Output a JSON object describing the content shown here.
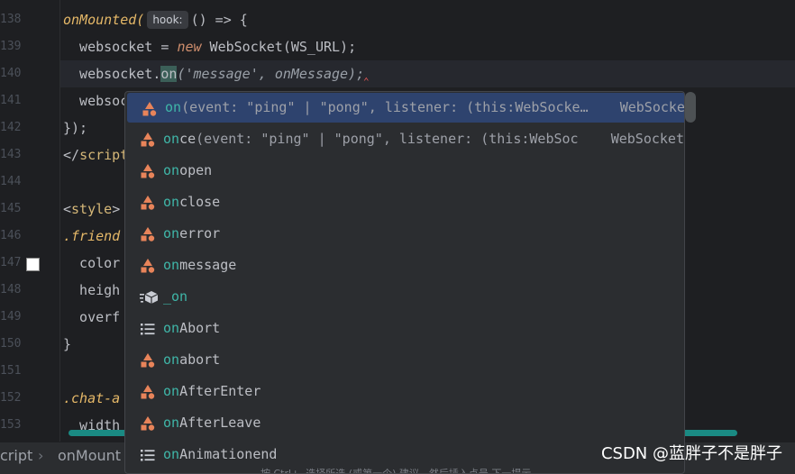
{
  "editor": {
    "line_numbers": [
      "138",
      "139",
      "140",
      "141",
      "142",
      "143",
      "144",
      "145",
      "146",
      "147",
      "148",
      "149",
      "150",
      "151",
      "152",
      "153"
    ],
    "lines": {
      "l138_fn": "onMounted(",
      "l138_hint": "hook:",
      "l138_rest": "() => {",
      "l139_a": "  websocket = ",
      "l139_kw": "new",
      "l139_b": " WebSocket(WS_URL);",
      "l140_a": "  websocket.",
      "l140_match": "on",
      "l140_paren": "(",
      "l140_str": "'message'",
      "l140_sep": ", ",
      "l140_param": "onMessage",
      "l140_end": ");",
      "l141": "  websoc",
      "l142": "});",
      "l143_a": "</",
      "l143_b": "script",
      "l145_a": "<",
      "l145_b": "style",
      "l145_c": ">",
      "l146": ".friend",
      "l147": "  color",
      "l148": "  heigh",
      "l149": "  overf",
      "l150": "}",
      "l152": ".chat-a",
      "l153": "  width"
    }
  },
  "autocomplete": {
    "items": [
      {
        "match": "on",
        "rest": "",
        "sig": "(event: \"ping\" | \"pong\", listener: (this:WebSocke…",
        "ret": "WebSocket",
        "icon": "shapes-icon"
      },
      {
        "match": "on",
        "rest": "ce",
        "sig": "(event: \"ping\" | \"pong\", listener: (this:WebSoc",
        "ret": "WebSocket",
        "icon": "shapes-icon"
      },
      {
        "match": "on",
        "rest": "open",
        "sig": "",
        "ret": "",
        "icon": "shapes-icon"
      },
      {
        "match": "on",
        "rest": "close",
        "sig": "",
        "ret": "",
        "icon": "shapes-icon"
      },
      {
        "match": "on",
        "rest": "error",
        "sig": "",
        "ret": "",
        "icon": "shapes-icon"
      },
      {
        "match": "on",
        "rest": "message",
        "sig": "",
        "ret": "",
        "icon": "shapes-icon"
      },
      {
        "match": "_on",
        "rest": "",
        "sig": "",
        "ret": "",
        "icon": "cube-icon"
      },
      {
        "match": "on",
        "rest": "Abort",
        "sig": "",
        "ret": "",
        "icon": "list-icon"
      },
      {
        "match": "on",
        "rest": "abort",
        "sig": "",
        "ret": "",
        "icon": "shapes-icon"
      },
      {
        "match": "on",
        "rest": "AfterEnter",
        "sig": "",
        "ret": "",
        "icon": "shapes-icon"
      },
      {
        "match": "on",
        "rest": "AfterLeave",
        "sig": "",
        "ret": "",
        "icon": "shapes-icon"
      },
      {
        "match": "on",
        "rest": "Animationend",
        "sig": "",
        "ret": "",
        "icon": "list-icon"
      }
    ],
    "footer_hint": "按 Ctrl+. 选择所选 (或第一个) 建议，然后插入点号 下一提示"
  },
  "statusbar": {
    "crumb1": "cript",
    "crumb2": "onMount"
  },
  "watermark": "CSDN @蓝胖子不是胖子",
  "colors": {
    "accent_match": "#3fb6a8",
    "selection": "#2e436e",
    "icon_orange": "#e8845a"
  }
}
